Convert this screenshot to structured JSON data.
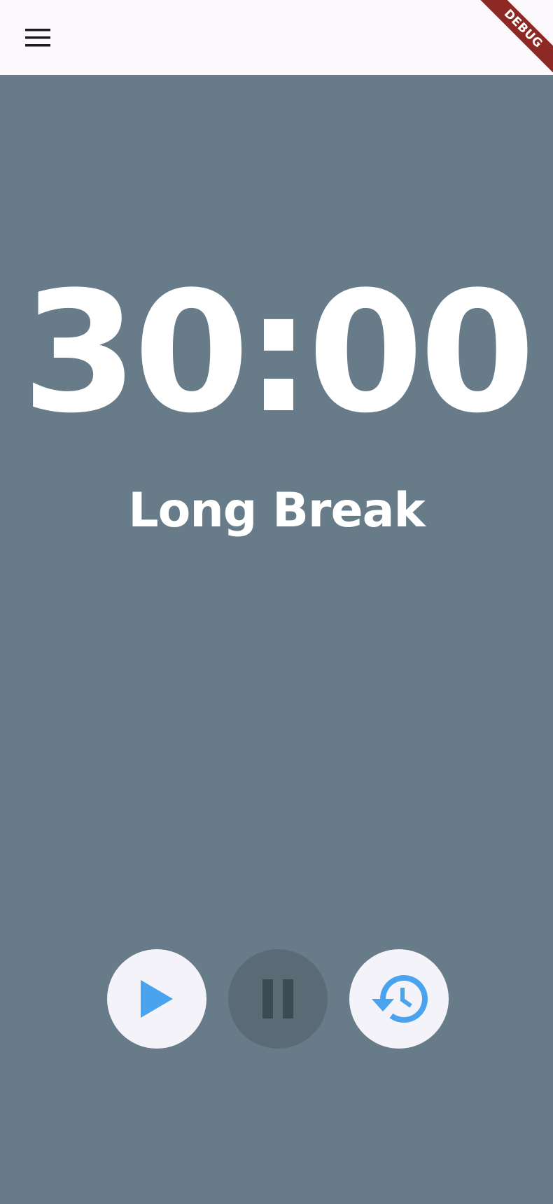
{
  "app_bar": {
    "menu_icon": "menu-icon",
    "debug_banner": "DEBUG"
  },
  "timer": {
    "time": "30:00",
    "mode": "Long Break"
  },
  "controls": {
    "play_icon": "play-icon",
    "pause_icon": "pause-icon",
    "reset_icon": "history-icon",
    "pause_disabled": true
  },
  "colors": {
    "background": "#677b88",
    "app_bar": "#fcf8fc",
    "button_bg": "#f4f3f9",
    "button_disabled_bg": "#5a6b76",
    "accent": "#4aa3ee",
    "disabled_icon": "#3c4a52",
    "debug_ribbon": "#8e2824"
  }
}
